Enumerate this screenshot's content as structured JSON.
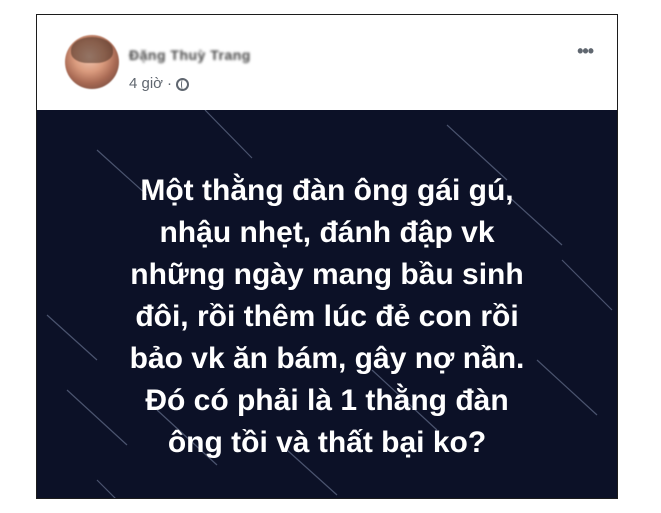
{
  "post": {
    "author": "Đặng Thuỳ Trang",
    "time": "4 giờ",
    "separator": "·",
    "privacy_icon": "globe-icon",
    "more_icon": "more-options-icon",
    "more_label": "•••",
    "image_text_lines": [
      "Một thằng đàn ông gái gú,",
      "nhậu nhẹt, đánh đập vk",
      "những ngày mang bầu sinh",
      "đôi, rồi thêm lúc đẻ con rồi",
      "bảo vk ăn bám, gây nợ nần.",
      "Đó có phải là 1 thằng đàn",
      "ông tồi và thất bại ko?"
    ],
    "colors": {
      "image_background": "#0c1127",
      "text": "#ffffff",
      "meta_text": "#606770"
    }
  }
}
